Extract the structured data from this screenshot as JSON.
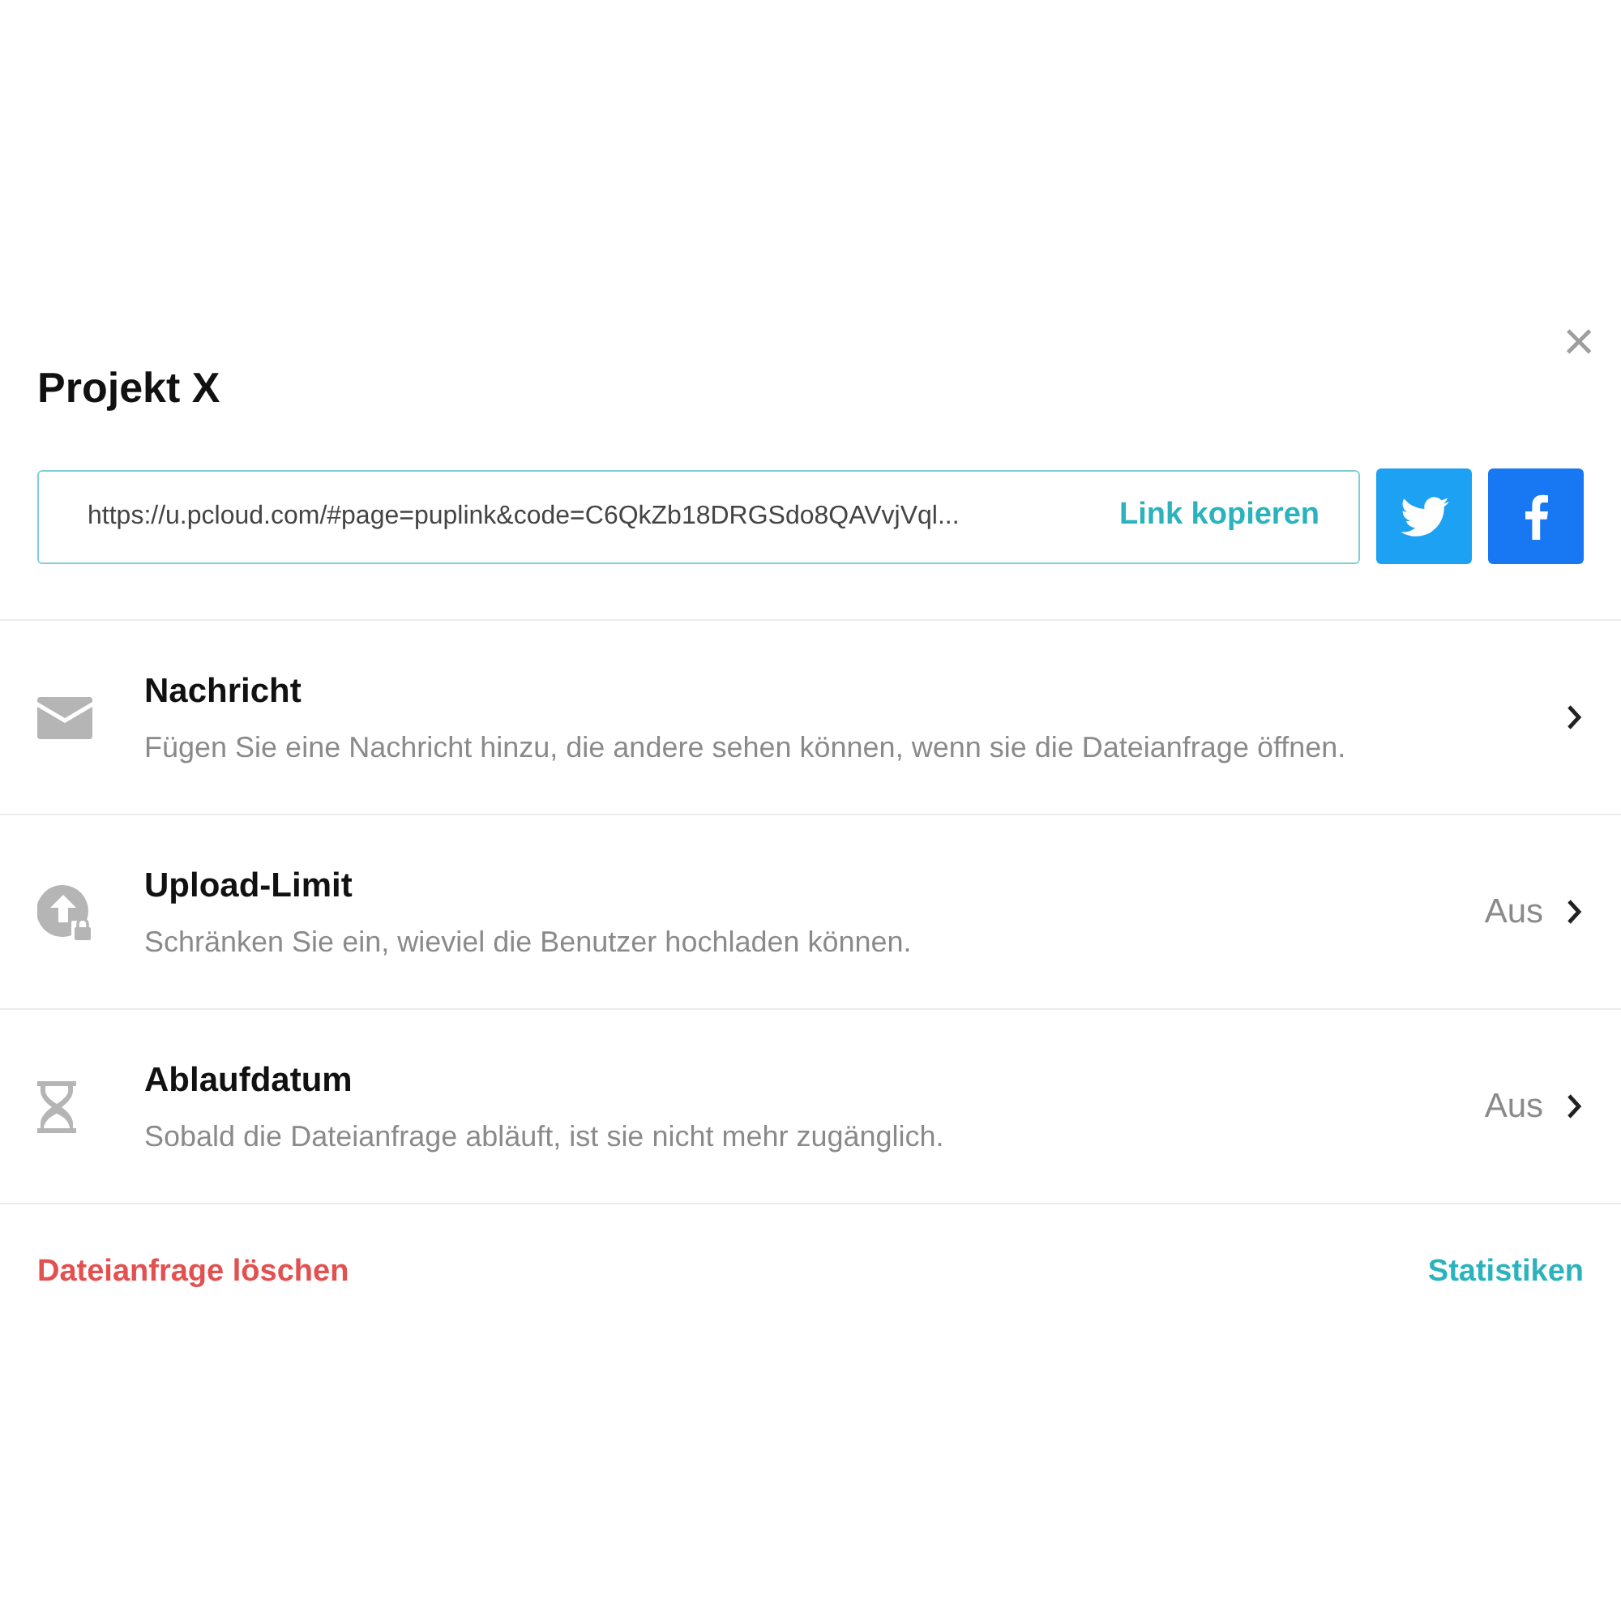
{
  "dialog": {
    "title": "Projekt X",
    "close": "×"
  },
  "share": {
    "link": "https://u.pcloud.com/#page=puplink&code=C6QkZb18DRGSdo8QAVvjVql...",
    "copy": "Link kopieren"
  },
  "settings": [
    {
      "kind": "message",
      "title": "Nachricht",
      "description": "Fügen Sie eine Nachricht hinzu, die andere sehen können, wenn sie die Dateianfrage öffnen."
    },
    {
      "kind": "upload",
      "title": "Upload-Limit",
      "description": "Schränken Sie ein, wieviel die Benutzer hochladen können.",
      "value": "Aus"
    },
    {
      "kind": "expiry",
      "title": "Ablaufdatum",
      "description": "Sobald die Dateianfrage abläuft, ist sie nicht mehr zugänglich.",
      "value": "Aus"
    }
  ],
  "footer": {
    "delete": "Dateianfrage löschen",
    "stats": "Statistiken"
  }
}
